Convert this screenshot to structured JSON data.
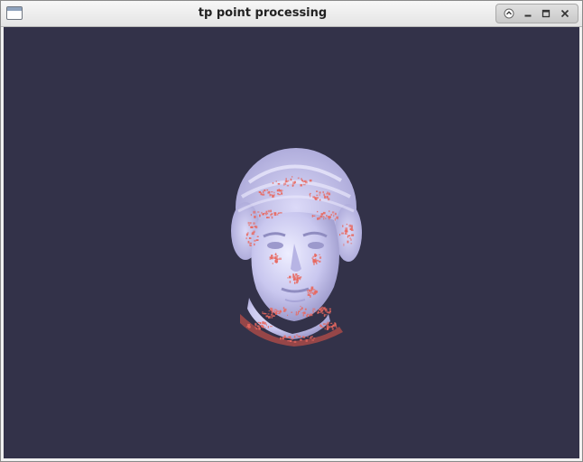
{
  "window": {
    "title": "tp point processing"
  },
  "icons": {
    "app": "app-window-icon",
    "shade": "shade-up-icon",
    "minimize": "minimize-icon",
    "maximize": "maximize-icon",
    "close": "close-icon"
  },
  "viewport": {
    "background_color": "#333249",
    "model": {
      "description_kind": "point-cloud-head",
      "base_color": "#c9c7ef",
      "highlight_color": "#e8685f"
    }
  }
}
